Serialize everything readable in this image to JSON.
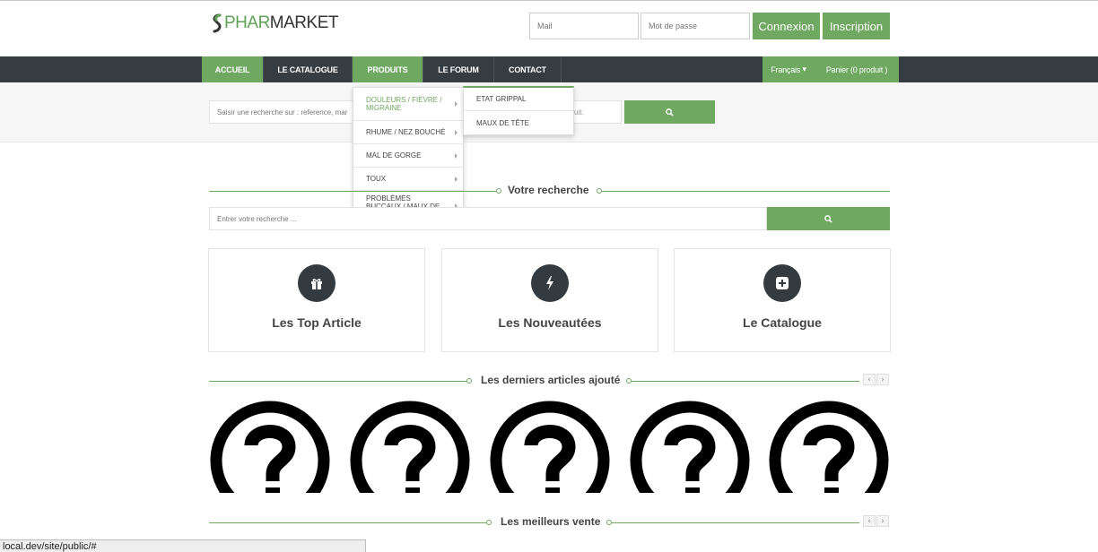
{
  "header": {
    "logo_part1": "PHAR",
    "logo_part2": "MARKET",
    "mail_placeholder": "Mail",
    "password_placeholder": "Mot de passe",
    "login_label": "Connexion",
    "signup_label": "Inscription"
  },
  "nav": {
    "items": [
      {
        "label": "ACCUEIL"
      },
      {
        "label": "LE CATALOGUE"
      },
      {
        "label": "PRODUITS"
      },
      {
        "label": "LE FORUM"
      },
      {
        "label": "CONTACT"
      }
    ],
    "language": "Français",
    "cart": "Panier (0 produit )"
  },
  "search_bar": {
    "placeholder_left": "Saisir une recherche sur : reference, mar",
    "placeholder_right": "uit."
  },
  "dropdown": {
    "items": [
      {
        "label": "DOULEURS / FIÈVRE / MIGRAINE"
      },
      {
        "label": "RHUME / NEZ BOUCHÉ"
      },
      {
        "label": "MAL DE GORGE"
      },
      {
        "label": "TOUX"
      },
      {
        "label": "PROBLÈMES BUCCAUX / MAUX DE BOUCHE"
      }
    ],
    "submenu": [
      {
        "label": "ETAT GRIPPAL"
      },
      {
        "label": "MAUX DE TÊTE"
      }
    ]
  },
  "search_section": {
    "title": "Votre recherche",
    "placeholder": "Entrer votre recherche ..."
  },
  "cards": [
    {
      "label": "Les Top Article",
      "icon": "gift-icon"
    },
    {
      "label": "Les Nouveautées",
      "icon": "bolt-icon"
    },
    {
      "label": "Le Catalogue",
      "icon": "plus-square-icon"
    }
  ],
  "latest_section": {
    "title": "Les derniers articles ajouté"
  },
  "best_section": {
    "title": "Les meilleurs vente"
  },
  "pager": {
    "prev": "‹",
    "next": "›"
  },
  "status_url": "local.dev/site/public/#",
  "colors": {
    "accent": "#6fa860",
    "nav_bg": "#353c42"
  }
}
